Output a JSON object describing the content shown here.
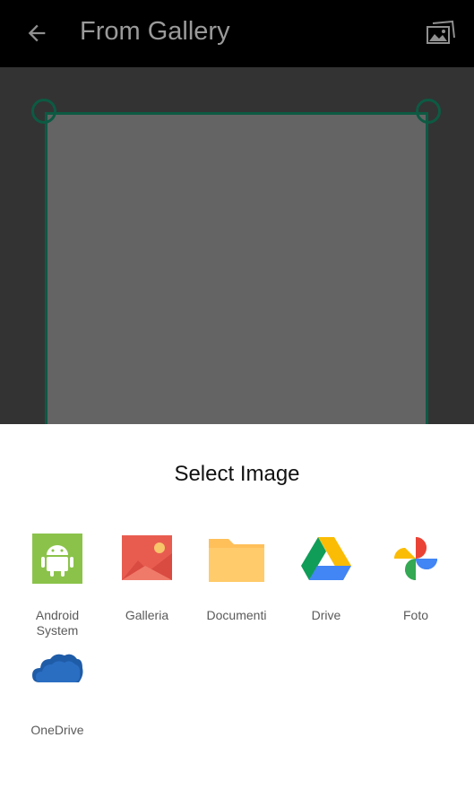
{
  "app_bar": {
    "title": "From Gallery",
    "back_icon": "arrow-back-icon",
    "gallery_icon": "gallery-image-icon"
  },
  "sheet": {
    "title": "Select Image",
    "apps": [
      {
        "label": "Android System",
        "icon": "android-icon"
      },
      {
        "label": "Galleria",
        "icon": "gallery-icon"
      },
      {
        "label": "Documenti",
        "icon": "folder-icon"
      },
      {
        "label": "Drive",
        "icon": "drive-icon"
      },
      {
        "label": "Foto",
        "icon": "photos-pinwheel-icon"
      },
      {
        "label": "OneDrive",
        "icon": "cloud-icon"
      }
    ]
  },
  "colors": {
    "app_bar": "#000000",
    "crop_frame": "#0d5a43",
    "android_green": "#8bc34a",
    "gallery_red": "#e85c50",
    "folder_yellow": "#ffc05a",
    "onedrive_blue": "#1f5ca8"
  }
}
